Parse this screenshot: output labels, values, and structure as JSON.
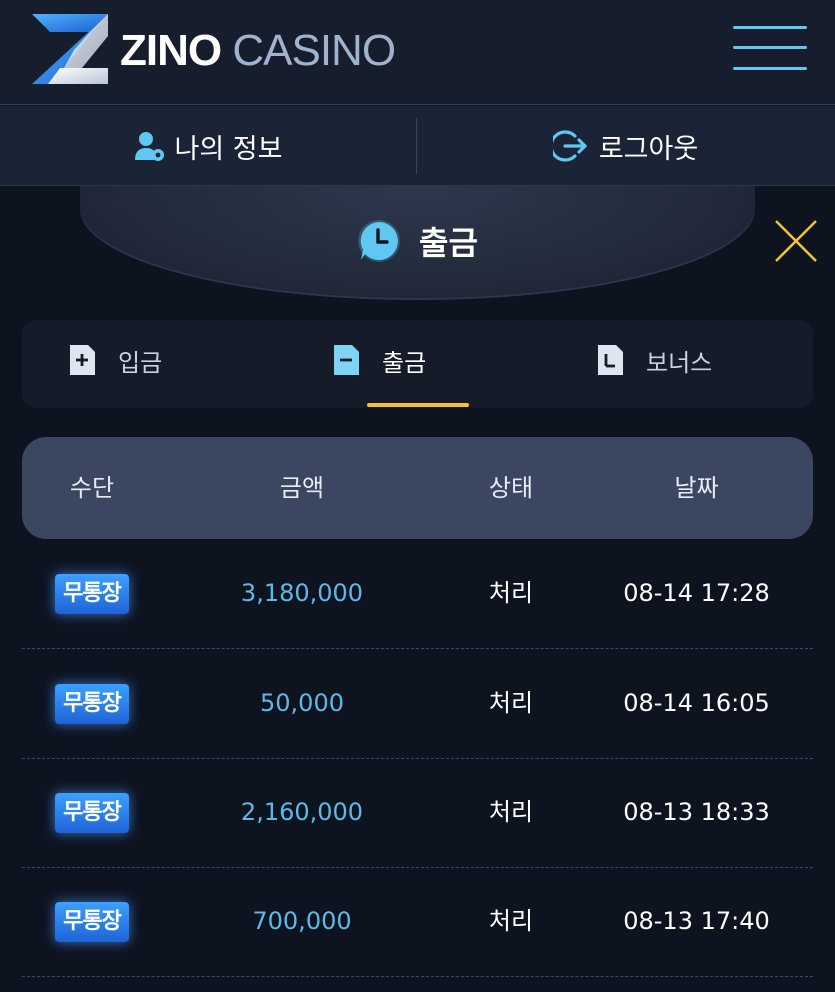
{
  "brand": {
    "name_primary": "ZINO",
    "name_secondary": "CASINO"
  },
  "header": {
    "menu_icon": "hamburger-icon"
  },
  "account": {
    "my_info_label": "나의 정보",
    "logout_label": "로그아웃",
    "my_info_icon": "user-gear-icon",
    "logout_icon": "logout-icon"
  },
  "panel": {
    "title": "출금",
    "title_icon": "clock-chat-icon",
    "close_icon": "close-icon"
  },
  "tabs": [
    {
      "label": "입금",
      "icon": "file-plus-icon",
      "active": false
    },
    {
      "label": "출금",
      "icon": "file-minus-icon",
      "active": true
    },
    {
      "label": "보너스",
      "icon": "file-clock-icon",
      "active": false
    }
  ],
  "table": {
    "headers": [
      "수단",
      "금액",
      "상태",
      "날짜"
    ],
    "rows": [
      {
        "method": "무통장",
        "amount": "3,180,000",
        "status": "처리",
        "date": "08-14 17:28"
      },
      {
        "method": "무통장",
        "amount": "50,000",
        "status": "처리",
        "date": "08-14 16:05"
      },
      {
        "method": "무통장",
        "amount": "2,160,000",
        "status": "처리",
        "date": "08-13 18:33"
      },
      {
        "method": "무통장",
        "amount": "700,000",
        "status": "처리",
        "date": "08-13 17:40"
      }
    ]
  },
  "colors": {
    "accent_blue": "#5ec8f1",
    "amount_blue": "#5fb8e6",
    "tab_underline": "#f4c531",
    "close_x": "#f4c531",
    "badge_blue": "#2a7fee"
  }
}
